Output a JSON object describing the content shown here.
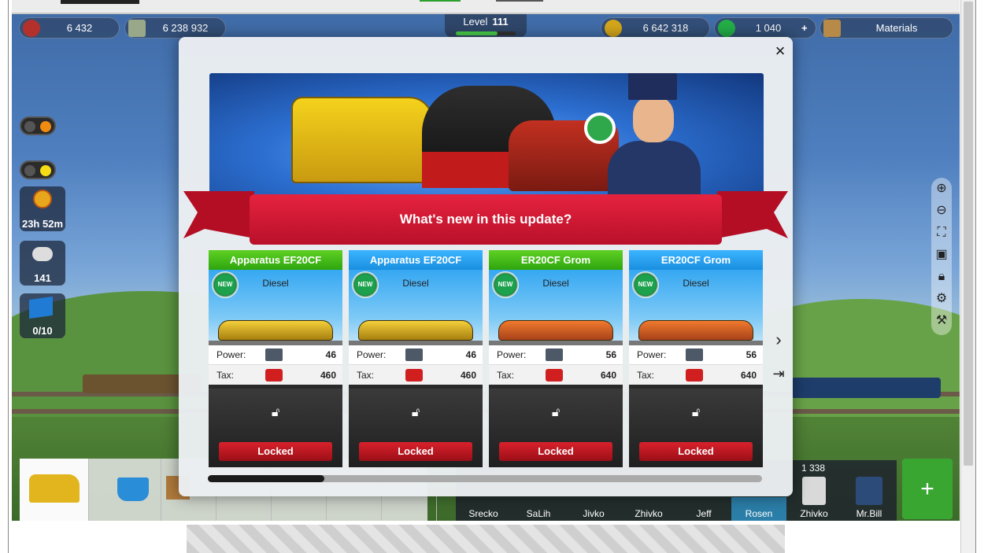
{
  "hud": {
    "stat1": "6 432",
    "stat2": "6 238 932",
    "level_label": "Level",
    "level_value": "111",
    "gold": "6 642 318",
    "gems": "1 040",
    "gems_plus": "+",
    "materials": "Materials",
    "level_progress": 0.7
  },
  "side": {
    "timer": "23h 52m",
    "whistle_count": "141",
    "flag_count": "0/10"
  },
  "modal": {
    "title": "What's new in this update?",
    "close_icon": "×",
    "next_icon": "›",
    "last_icon": "⇥",
    "scroll_progress": 0.21,
    "cards": [
      {
        "name": "Apparatus EF20CF",
        "badge": "NEW",
        "type": "Diesel",
        "power_label": "Power:",
        "power": "46",
        "tax_label": "Tax:",
        "tax": "460",
        "button": "Locked",
        "header_color": "green",
        "loco_color": "yellow"
      },
      {
        "name": "Apparatus EF20CF",
        "badge": "NEW",
        "type": "Diesel",
        "power_label": "Power:",
        "power": "46",
        "tax_label": "Tax:",
        "tax": "460",
        "button": "Locked",
        "header_color": "blue",
        "loco_color": "yellow"
      },
      {
        "name": "ER20CF Grom",
        "badge": "NEW",
        "type": "Diesel",
        "power_label": "Power:",
        "power": "56",
        "tax_label": "Tax:",
        "tax": "640",
        "button": "Locked",
        "header_color": "green",
        "loco_color": "orange"
      },
      {
        "name": "ER20CF Grom",
        "badge": "NEW",
        "type": "Diesel",
        "power_label": "Power:",
        "power": "56",
        "tax_label": "Tax:",
        "tax": "640",
        "button": "Locked",
        "header_color": "blue",
        "loco_color": "orange"
      }
    ]
  },
  "friends": {
    "count": "1 338",
    "names": [
      "Srecko",
      "SaLih",
      "Jivko",
      "Zhivko",
      "Jeff",
      "Rosen",
      "Zhivko",
      "Mr.Bill"
    ],
    "selected": "Rosen"
  },
  "colors": {
    "accent_red": "#c21b2a",
    "new_green": "#1ca24d",
    "header_green": "#3fb818",
    "header_blue": "#2aa0f0"
  }
}
